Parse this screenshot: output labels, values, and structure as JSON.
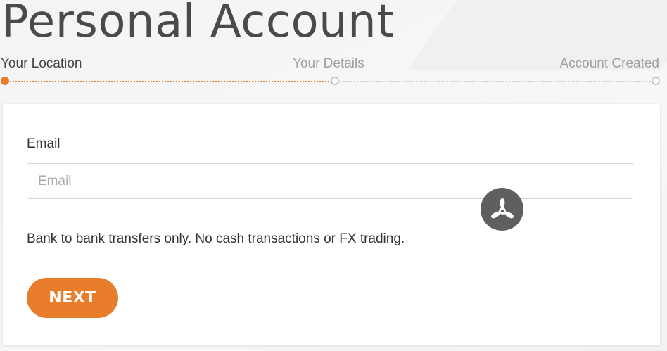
{
  "header": {
    "title": "Personal Account"
  },
  "steps": [
    {
      "label": "Your Location",
      "state": "active"
    },
    {
      "label": "Your Details",
      "state": "pending"
    },
    {
      "label": "Account Created",
      "state": "pending"
    }
  ],
  "form": {
    "email_label": "Email",
    "email_placeholder": "Email",
    "email_value": "",
    "note": "Bank to bank transfers only. No cash transactions or FX trading.",
    "next_label": "NEXT"
  },
  "overlay": {
    "icon": "tri-blade-logo-icon"
  },
  "colors": {
    "accent": "#e87d2b",
    "badge": "#5f5f5f",
    "title": "#4a4a4a"
  }
}
